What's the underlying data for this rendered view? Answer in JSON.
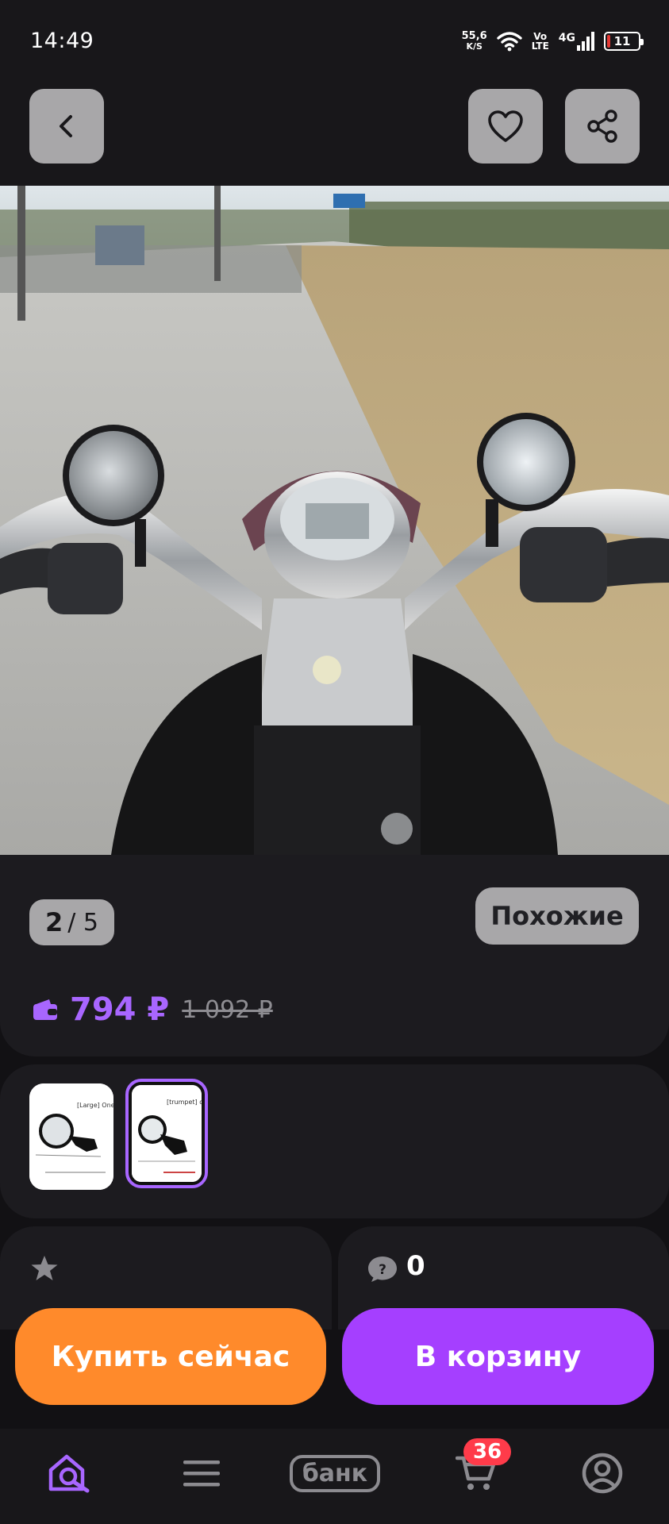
{
  "status_bar": {
    "time": "14:49",
    "net_speed_value": "55,6",
    "net_speed_unit": "K/S",
    "volte_top": "Vo",
    "volte_bottom": "LTE",
    "network": "4G",
    "battery": "11",
    "battery_color": "#e53935"
  },
  "app_bar": {
    "back_icon": "arrow-left-icon",
    "favorite_icon": "heart-icon",
    "share_icon": "share-icon"
  },
  "gallery": {
    "current": "2",
    "total": "/ 5",
    "similar_label": "Похожие"
  },
  "price": {
    "current": "794 ₽",
    "old": "1 092 ₽",
    "accent_color": "#a866ff",
    "wallet_icon": "wallet-icon"
  },
  "variants": {
    "items": [
      {
        "caption_top": "[Large] One",
        "selected": false
      },
      {
        "caption_top": "[trumpet] o",
        "selected": true
      }
    ]
  },
  "reviews": {
    "star_icon": "star-icon",
    "questions_icon": "question-bubble-icon",
    "questions_count": "0"
  },
  "actions": {
    "buy_now": "Купить сейчас",
    "add_to_cart": "В корзину",
    "buy_color": "#ff8a2b",
    "cart_color": "#a53fff"
  },
  "bottom_nav": {
    "bank_label": "банк",
    "cart_badge": "36",
    "active_color": "#a866ff"
  }
}
